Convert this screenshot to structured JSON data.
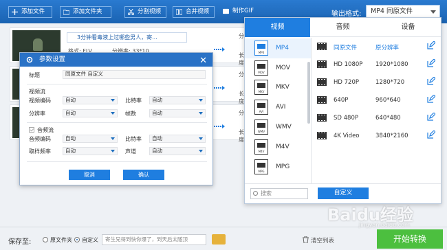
{
  "toolbar": {
    "add_file": "添加文件",
    "add_folder": "添加文件夹",
    "split_video": "分割视频",
    "merge_video": "合并视频",
    "make_gif": "制作GIF",
    "output_format_label": "输出格式:",
    "output_format_value": "MP4  同原文件"
  },
  "file_rows": [
    {
      "title": "3分钟看毒液上过哪些男人，寄...",
      "format_label": "格式: FLV",
      "resolution_label": "分辨率: 33*10",
      "right_top": "分",
      "right_bottom": "长度:"
    },
    {
      "right_top": "分",
      "right_bottom": "长度:"
    },
    {
      "right_top": "分",
      "right_bottom": "长度:"
    }
  ],
  "params_dialog": {
    "title": "参数设置",
    "close": "✕",
    "title_label": "标题",
    "title_value": "同原文件 自定义",
    "video_stream": "视频流",
    "video_codec_label": "视频编码",
    "video_codec_value": "自动",
    "bitrate_label": "比特率",
    "bitrate_value": "自动",
    "resolution_label": "分辨率",
    "resolution_value": "自动",
    "fps_label": "帧数",
    "fps_value": "自动",
    "audio_stream": "音频流",
    "audio_codec_label": "音频编码",
    "audio_codec_value": "自动",
    "audio_bitrate_label": "比特率",
    "audio_bitrate_value": "自动",
    "sample_rate_label": "取样频率",
    "sample_rate_value": "自动",
    "channel_label": "声道",
    "channel_value": "自动",
    "cancel": "取消",
    "confirm": "确认"
  },
  "format_panel": {
    "tabs": [
      "视频",
      "音频",
      "设备"
    ],
    "formats": [
      "MP4",
      "MOV",
      "MKV",
      "AVI",
      "WMV",
      "M4V",
      "MPG"
    ],
    "format_icon_labels": [
      "MP4",
      "MOV",
      "MKV",
      "AVI",
      "WMV",
      "M4V",
      "MPG"
    ],
    "resolutions": [
      {
        "name": "同原文件",
        "value": "原分辨率"
      },
      {
        "name": "HD 1080P",
        "value": "1920*1080"
      },
      {
        "name": "HD 720P",
        "value": "1280*720"
      },
      {
        "name": "640P",
        "value": "960*640"
      },
      {
        "name": "SD 480P",
        "value": "640*480"
      },
      {
        "name": "4K Video",
        "value": "3840*2160"
      }
    ],
    "search_placeholder": "搜索",
    "custom_button": "自定义"
  },
  "footer": {
    "save_to": "保存至:",
    "option_original_folder": "原文件夹",
    "option_custom": "自定义",
    "path_value": "寄生兄得到快你爆了，到天后太随顶",
    "clear_list": "清空列表",
    "start_convert": "开始转换"
  },
  "watermark": {
    "brand": "Baidu经验",
    "url": "jingyan.baidu.com"
  },
  "colors": {
    "primary": "#1f7ee0",
    "toolbar": "#1e6fbf",
    "start": "#4cbf3f"
  }
}
